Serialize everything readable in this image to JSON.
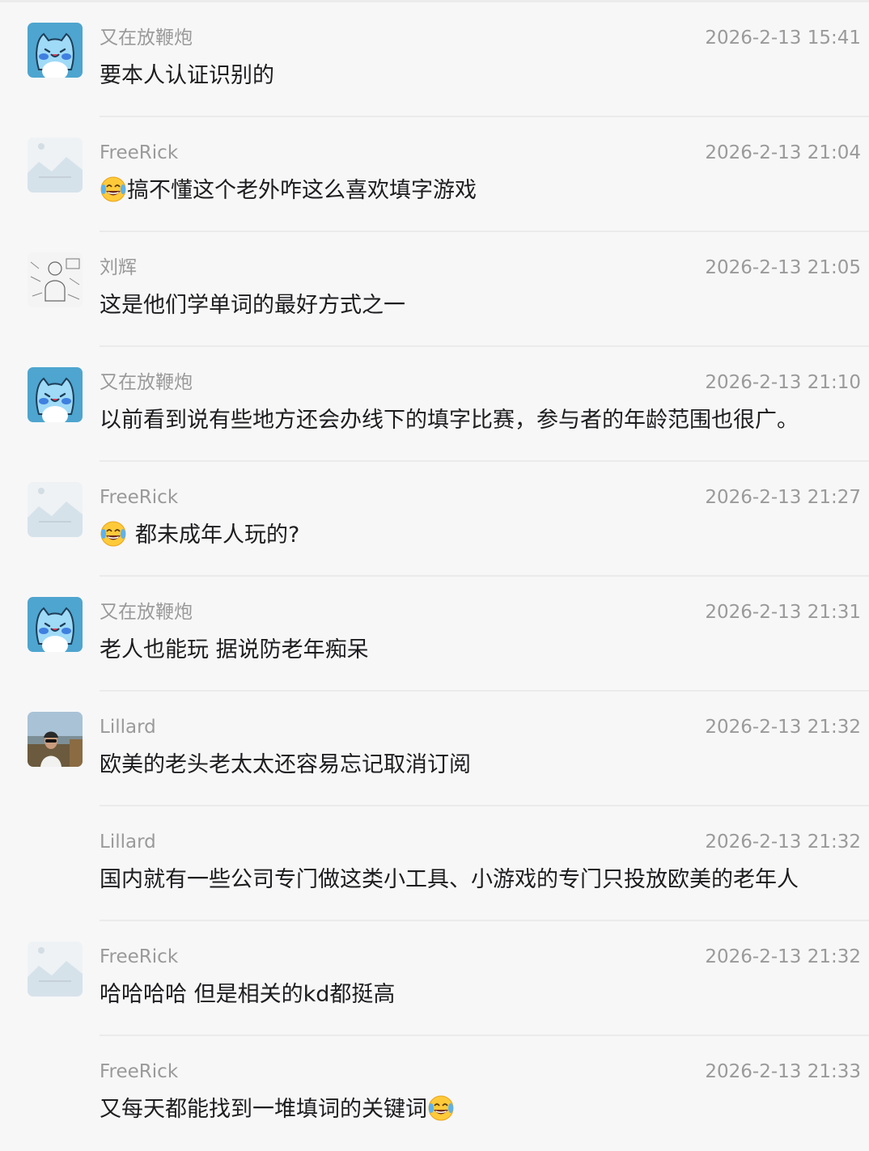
{
  "comments": [
    {
      "author": "又在放鞭炮",
      "time": "2026-2-13 15:41",
      "avatar": "cat-avatar",
      "text": "要本人认证识别的",
      "emoji_lead": false,
      "emoji_lead_gap": false,
      "emoji_trail": false
    },
    {
      "author": "FreeRick",
      "time": "2026-2-13 21:04",
      "avatar": "landscape-placeholder-avatar",
      "text": "搞不懂这个老外咋这么喜欢填字游戏",
      "emoji_lead": true,
      "emoji_lead_gap": false,
      "emoji_trail": false
    },
    {
      "author": "刘辉",
      "time": "2026-2-13 21:05",
      "avatar": "sketch-avatar",
      "text": "这是他们学单词的最好方式之一",
      "emoji_lead": false,
      "emoji_lead_gap": false,
      "emoji_trail": false
    },
    {
      "author": "又在放鞭炮",
      "time": "2026-2-13 21:10",
      "avatar": "cat-avatar",
      "text": "以前看到说有些地方还会办线下的填字比赛，参与者的年龄范围也很广。",
      "emoji_lead": false,
      "emoji_lead_gap": false,
      "emoji_trail": false
    },
    {
      "author": "FreeRick",
      "time": "2026-2-13 21:27",
      "avatar": "landscape-placeholder-avatar",
      "text": "都未成年人玩的?",
      "emoji_lead": true,
      "emoji_lead_gap": true,
      "emoji_trail": false
    },
    {
      "author": "又在放鞭炮",
      "time": "2026-2-13 21:31",
      "avatar": "cat-avatar",
      "text": "老人也能玩 据说防老年痴呆",
      "emoji_lead": false,
      "emoji_lead_gap": false,
      "emoji_trail": false
    },
    {
      "author": "Lillard",
      "time": "2026-2-13 21:32",
      "avatar": "photo-avatar",
      "text": "欧美的老头老太太还容易忘记取消订阅",
      "emoji_lead": false,
      "emoji_lead_gap": false,
      "emoji_trail": false
    },
    {
      "author": "Lillard",
      "time": "2026-2-13 21:32",
      "avatar": "none",
      "text": "国内就有一些公司专门做这类小工具、小游戏的专门只投放欧美的老年人",
      "emoji_lead": false,
      "emoji_lead_gap": false,
      "emoji_trail": false
    },
    {
      "author": "FreeRick",
      "time": "2026-2-13 21:32",
      "avatar": "landscape-placeholder-avatar",
      "text": "哈哈哈哈 但是相关的kd都挺高",
      "emoji_lead": false,
      "emoji_lead_gap": false,
      "emoji_trail": false
    },
    {
      "author": "FreeRick",
      "time": "2026-2-13 21:33",
      "avatar": "none",
      "text": "又每天都能找到一堆填词的关键词",
      "emoji_lead": false,
      "emoji_lead_gap": false,
      "emoji_trail": true
    }
  ],
  "emoji_name": "tears-of-joy-emoji",
  "colors": {
    "background": "#f7f7f8",
    "meta_text": "#9a9a9a",
    "body_text": "#1d1d1f",
    "cat_avatar_bg": "#4ea5cf"
  }
}
